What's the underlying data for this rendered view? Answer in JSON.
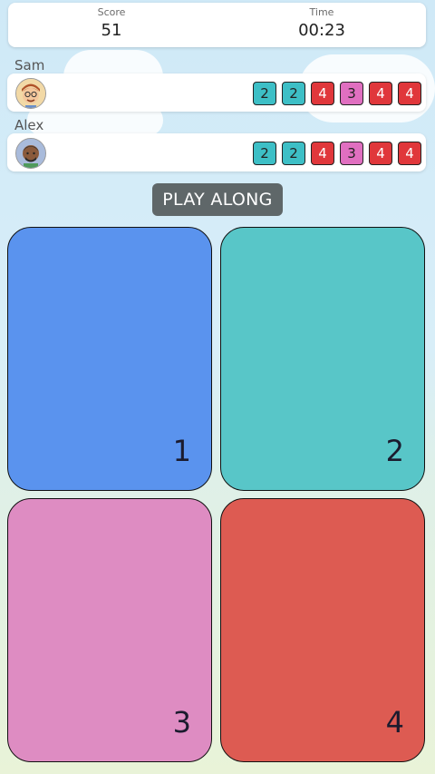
{
  "score": {
    "label": "Score",
    "value": "51"
  },
  "time": {
    "label": "Time",
    "value": "00:23"
  },
  "players": [
    {
      "name": "Sam",
      "sequence": [
        "2",
        "2",
        "4",
        "3",
        "4",
        "4"
      ]
    },
    {
      "name": "Alex",
      "sequence": [
        "2",
        "2",
        "4",
        "3",
        "4",
        "4"
      ]
    }
  ],
  "play_button": "PLAY ALONG",
  "pads": [
    {
      "number": "1",
      "color": "#5a93ee"
    },
    {
      "number": "2",
      "color": "#58c6c8"
    },
    {
      "number": "3",
      "color": "#de8cc2"
    },
    {
      "number": "4",
      "color": "#dd5b52"
    }
  ],
  "chip_colors": {
    "2": "#3dbfc6",
    "3": "#e06fc0",
    "4": "#e0373b"
  }
}
